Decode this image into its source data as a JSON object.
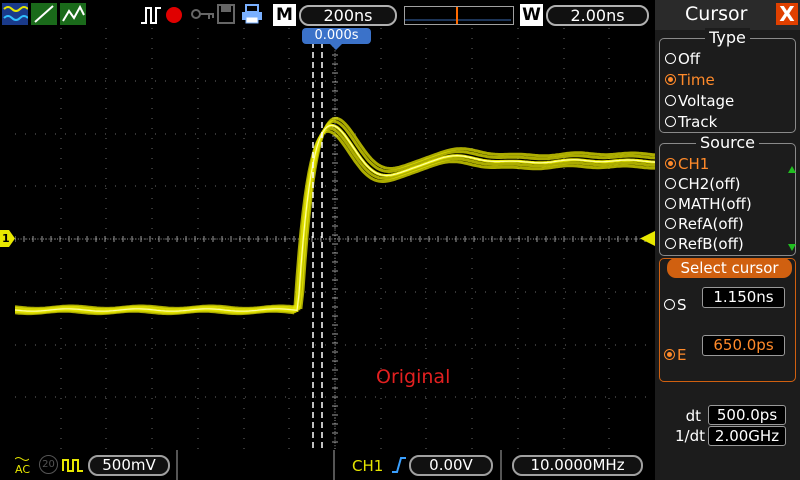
{
  "toolbar": {
    "timebase": "200ns",
    "delay_badge": "M",
    "wave_badge": "W",
    "window_time": "2.00ns",
    "trigger_offset": "0.000s"
  },
  "bottom": {
    "coupling": "AC",
    "bw_limit": "20",
    "ch1_scale": "500mV",
    "trigger_source": "CH1",
    "trigger_level": "0.00V",
    "frequency": "10.0000MHz"
  },
  "overlay": {
    "watermark": "Original",
    "channel_marker": "1"
  },
  "panel": {
    "title": "Cursor",
    "close": "X",
    "type_group": {
      "title": "Type",
      "options": [
        "Off",
        "Time",
        "Voltage",
        "Track"
      ],
      "selected": "Time"
    },
    "source_group": {
      "title": "Source",
      "options": [
        "CH1",
        "CH2(off)",
        "MATH(off)",
        "RefA(off)",
        "RefB(off)"
      ],
      "selected": "CH1"
    },
    "select_cursor": {
      "title": "Select cursor",
      "s_label": "S",
      "s_value": "1.150ns",
      "e_label": "E",
      "e_value": "650.0ps",
      "selected": "E"
    },
    "measurements": {
      "dt_label": "dt",
      "dt_value": "500.0ps",
      "inv_dt_label": "1/dt",
      "inv_dt_value": "2.00GHz"
    }
  },
  "colors": {
    "trace": "#e6e600",
    "accent": "#ff8a2a",
    "trigger_blue": "#3b72c9",
    "close_red": "#e04000",
    "watermark": "#e32020"
  }
}
